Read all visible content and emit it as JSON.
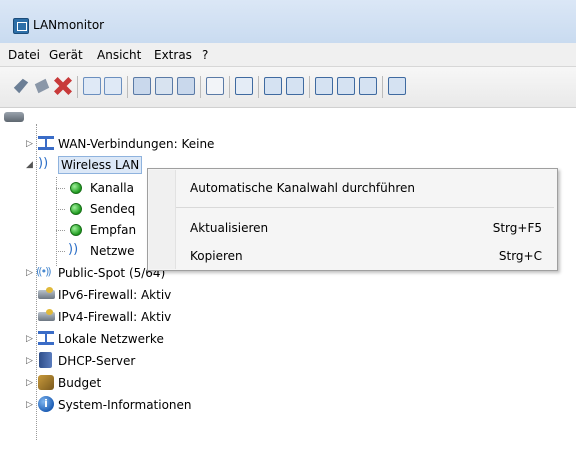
{
  "window": {
    "title": "LANmonitor"
  },
  "menu": [
    "Datei",
    "Gerät",
    "Ansicht",
    "Extras",
    "?"
  ],
  "tree": {
    "root_label": "",
    "items": [
      {
        "label": "WAN-Verbindungen: Keine",
        "icon": "network-icon"
      },
      {
        "label": "Wireless LAN",
        "icon": "wireless-icon",
        "selected": true
      },
      {
        "label": "Kanalla",
        "icon": "green-status-icon"
      },
      {
        "label": "Sendeq",
        "icon": "green-status-icon"
      },
      {
        "label": "Empfan",
        "icon": "green-status-icon"
      },
      {
        "label": "Netzwe",
        "icon": "wireless-icon"
      },
      {
        "label": "Public-Spot (5/64)",
        "icon": "public-spot-icon"
      },
      {
        "label": "IPv6-Firewall: Aktiv",
        "icon": "firewall-icon"
      },
      {
        "label": "IPv4-Firewall: Aktiv",
        "icon": "firewall-icon"
      },
      {
        "label": "Lokale Netzwerke",
        "icon": "network-icon"
      },
      {
        "label": "DHCP-Server",
        "icon": "server-icon"
      },
      {
        "label": "Budget",
        "icon": "budget-icon"
      },
      {
        "label": "System-Informationen",
        "icon": "info-icon"
      }
    ]
  },
  "context_menu": {
    "items": [
      {
        "label": "Automatische Kanalwahl durchführen",
        "shortcut": ""
      },
      {
        "label": "Aktualisieren",
        "shortcut": "Strg+F5"
      },
      {
        "label": "Kopieren",
        "shortcut": "Strg+C"
      }
    ]
  }
}
